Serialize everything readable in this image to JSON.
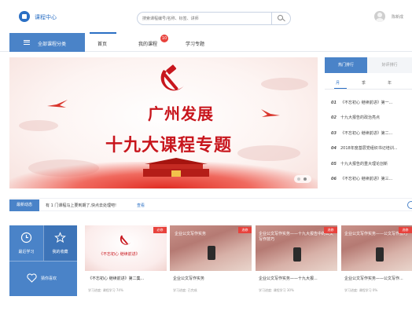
{
  "header": {
    "app_title": "课程中心",
    "search_placeholder": "搜索课程编号/名称、标签、讲师",
    "username": "陈新成"
  },
  "nav": {
    "category_label": "全部课程分类",
    "tabs": [
      {
        "label": "首页",
        "active": true
      },
      {
        "label": "我的课程",
        "badge": "10"
      },
      {
        "label": "学习专题"
      }
    ]
  },
  "banner": {
    "title": "广州发展",
    "subtitle": "十九大课程专题"
  },
  "ranking": {
    "tabs": [
      "热门排行",
      "好评排行"
    ],
    "periods": [
      "月",
      "季",
      "年"
    ],
    "items": [
      {
        "rank": "01",
        "title": "《不忘初心 继续前进》第一..."
      },
      {
        "rank": "02",
        "title": "十九大报告的政治亮点"
      },
      {
        "rank": "03",
        "title": "《不忘初心 继续前进》第二..."
      },
      {
        "rank": "04",
        "title": "2018年度基层党组织书记培训..."
      },
      {
        "rank": "05",
        "title": "十九大报告的重大理论创新"
      },
      {
        "rank": "06",
        "title": "《不忘初心 继续前进》第三..."
      }
    ]
  },
  "notice": {
    "tag": "最新动态",
    "text": "有 1 门课程马上要到期了,快点去处理吧!",
    "link": "查看"
  },
  "quick": {
    "items": [
      "最近学习",
      "我的收藏",
      "猜你喜欢"
    ]
  },
  "courses": [
    {
      "title": "《不忘初心 继续前进》第二集...",
      "progress": "学习进度: 课程学习 74%",
      "ribbon": "必修",
      "thumb_label": "《不忘初心 继续前进》",
      "thumb_type": "party"
    },
    {
      "title": "企业公文写作实务",
      "progress": "学习进度: 已完成",
      "ribbon": "选修",
      "thumb_label": "企业公文写作实务",
      "thumb_type": "office"
    },
    {
      "title": "企业公文写作实务——十九大报...",
      "progress": "学习进度: 课程学习 30%",
      "ribbon": "选修",
      "thumb_label": "企业公文写作实务——十九大报告中的公文写作技巧",
      "thumb_type": "office"
    },
    {
      "title": "企业公文写作实务——公文写作...",
      "progress": "学习进度: 课程学习 0%",
      "ribbon": "选修",
      "thumb_label": "企业公文写作实务——公文写作技巧",
      "thumb_type": "office"
    }
  ],
  "colors": {
    "primary": "#4a83c8",
    "brand_blue": "#2a6fc4",
    "party_red": "#c8161d",
    "badge_red": "#e8423c"
  },
  "icons": [
    "logo-icon",
    "search-icon",
    "avatar-icon",
    "menu-icon",
    "clock-icon",
    "star-icon",
    "heart-icon",
    "arrow-right-icon"
  ]
}
